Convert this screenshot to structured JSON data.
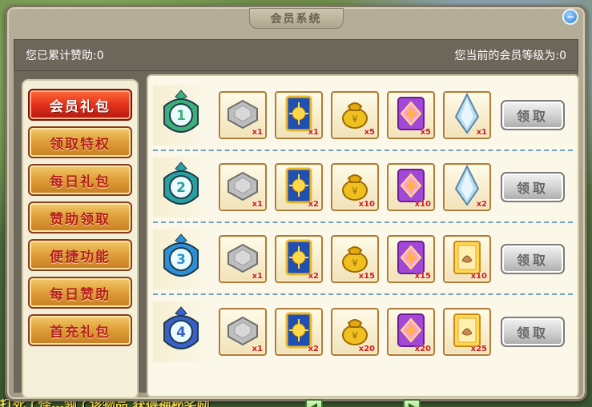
{
  "window": {
    "title": "会员系统",
    "close_glyph": "−"
  },
  "info": {
    "total_support_label": "您已累计赞助:0",
    "vip_level_label": "您当前的会员等级为:0"
  },
  "sidebar": {
    "items": [
      {
        "label": "会员礼包",
        "active": true
      },
      {
        "label": "领取特权",
        "active": false
      },
      {
        "label": "每日礼包",
        "active": false
      },
      {
        "label": "赞助领取",
        "active": false
      },
      {
        "label": "便捷功能",
        "active": false
      },
      {
        "label": "每日赞助",
        "active": false
      },
      {
        "label": "首充礼包",
        "active": false
      }
    ]
  },
  "tiers": [
    {
      "level": "1",
      "badge_color": "#3fae7a",
      "rewards": [
        {
          "icon": "stone-icon",
          "qty": "x1"
        },
        {
          "icon": "card-icon",
          "qty": "x1"
        },
        {
          "icon": "gold-bag-icon",
          "qty": "x5"
        },
        {
          "icon": "purple-scroll-icon",
          "qty": "x5"
        },
        {
          "icon": "crystal-icon",
          "qty": "x1"
        }
      ],
      "claim_label": "领取"
    },
    {
      "level": "2",
      "badge_color": "#2aa0a0",
      "rewards": [
        {
          "icon": "stone-icon",
          "qty": "x1"
        },
        {
          "icon": "card-icon",
          "qty": "x2"
        },
        {
          "icon": "gold-bag-icon",
          "qty": "x10"
        },
        {
          "icon": "purple-scroll-icon",
          "qty": "x10"
        },
        {
          "icon": "crystal-icon",
          "qty": "x2"
        }
      ],
      "claim_label": "领取"
    },
    {
      "level": "3",
      "badge_color": "#2f8fd6",
      "rewards": [
        {
          "icon": "stone-icon",
          "qty": "x1"
        },
        {
          "icon": "card-icon",
          "qty": "x2"
        },
        {
          "icon": "gold-bag-icon",
          "qty": "x15"
        },
        {
          "icon": "purple-scroll-icon",
          "qty": "x15"
        },
        {
          "icon": "pet-card-icon",
          "qty": "x10"
        }
      ],
      "claim_label": "领取"
    },
    {
      "level": "4",
      "badge_color": "#3a60c8",
      "rewards": [
        {
          "icon": "stone-icon",
          "qty": "x1"
        },
        {
          "icon": "card-icon",
          "qty": "x2"
        },
        {
          "icon": "gold-bag-icon",
          "qty": "x20"
        },
        {
          "icon": "purple-scroll-icon",
          "qty": "x20"
        },
        {
          "icon": "pet-card-icon",
          "qty": "x25"
        }
      ],
      "claim_label": "领取"
    }
  ],
  "pager": {
    "prev_icon": "arrow-left-icon",
    "next_icon": "arrow-right-icon"
  },
  "background_text": "打死了怪…领了该物品 获得神秘奖励"
}
